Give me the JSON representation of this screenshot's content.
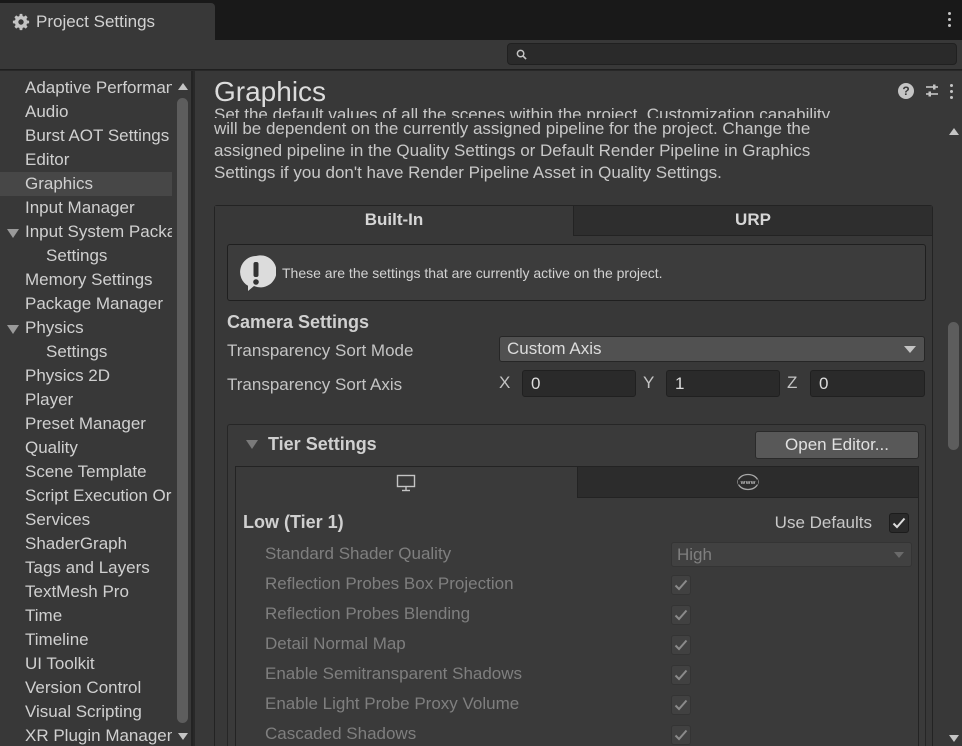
{
  "window": {
    "tab_title": "Project Settings",
    "tab_icon": "gear-icon"
  },
  "search": {
    "placeholder": "",
    "value": ""
  },
  "sidebar": {
    "selected": "Graphics",
    "items": [
      {
        "label": "Adaptive Performance",
        "indent": 0,
        "foldout": false
      },
      {
        "label": "Audio",
        "indent": 0,
        "foldout": false
      },
      {
        "label": "Burst AOT Settings",
        "indent": 0,
        "foldout": false
      },
      {
        "label": "Editor",
        "indent": 0,
        "foldout": false
      },
      {
        "label": "Graphics",
        "indent": 0,
        "foldout": false
      },
      {
        "label": "Input Manager",
        "indent": 0,
        "foldout": false
      },
      {
        "label": "Input System Package",
        "indent": 0,
        "foldout": true
      },
      {
        "label": "Settings",
        "indent": 1,
        "foldout": false
      },
      {
        "label": "Memory Settings",
        "indent": 0,
        "foldout": false
      },
      {
        "label": "Package Manager",
        "indent": 0,
        "foldout": false
      },
      {
        "label": "Physics",
        "indent": 0,
        "foldout": true
      },
      {
        "label": "Settings",
        "indent": 1,
        "foldout": false
      },
      {
        "label": "Physics 2D",
        "indent": 0,
        "foldout": false
      },
      {
        "label": "Player",
        "indent": 0,
        "foldout": false
      },
      {
        "label": "Preset Manager",
        "indent": 0,
        "foldout": false
      },
      {
        "label": "Quality",
        "indent": 0,
        "foldout": false
      },
      {
        "label": "Scene Template",
        "indent": 0,
        "foldout": false
      },
      {
        "label": "Script Execution Order",
        "indent": 0,
        "foldout": false
      },
      {
        "label": "Services",
        "indent": 0,
        "foldout": false
      },
      {
        "label": "ShaderGraph",
        "indent": 0,
        "foldout": false
      },
      {
        "label": "Tags and Layers",
        "indent": 0,
        "foldout": false
      },
      {
        "label": "TextMesh Pro",
        "indent": 0,
        "foldout": false
      },
      {
        "label": "Time",
        "indent": 0,
        "foldout": false
      },
      {
        "label": "Timeline",
        "indent": 0,
        "foldout": false
      },
      {
        "label": "UI Toolkit",
        "indent": 0,
        "foldout": false
      },
      {
        "label": "Version Control",
        "indent": 0,
        "foldout": false
      },
      {
        "label": "Visual Scripting",
        "indent": 0,
        "foldout": false
      },
      {
        "label": "XR Plugin Management",
        "indent": 0,
        "foldout": false
      }
    ]
  },
  "main": {
    "title": "Graphics",
    "description_clipped": "Set the default values of all the scenes within the project. Customization capability",
    "description_lines": [
      "will be dependent on the currently assigned pipeline for the project. Change the",
      "assigned pipeline in the Quality Settings or Default Render Pipeline in Graphics",
      "Settings if you don't have Render Pipeline Asset in Quality Settings."
    ],
    "pipeline_tabs": [
      "Built-In",
      "URP"
    ],
    "active_pipeline_tab": "Built-In",
    "info_box": "These are the settings that are currently active on the project.",
    "camera": {
      "section_title": "Camera Settings",
      "sort_mode_label": "Transparency Sort Mode",
      "sort_mode_value": "Custom Axis",
      "sort_axis_label": "Transparency Sort Axis",
      "axis": {
        "x_label": "X",
        "x": "0",
        "y_label": "Y",
        "y": "1",
        "z_label": "Z",
        "z": "0"
      }
    },
    "tier": {
      "section_title": "Tier Settings",
      "open_editor_label": "Open Editor...",
      "platform_tabs": [
        "standalone-monitor-icon",
        "webgl-www-icon"
      ],
      "tier_name": "Low (Tier 1)",
      "use_defaults_label": "Use Defaults",
      "use_defaults": true,
      "shader_quality_label": "Standard Shader Quality",
      "shader_quality_value": "High",
      "properties": [
        {
          "label": "Reflection Probes Box Projection",
          "checked": true
        },
        {
          "label": "Reflection Probes Blending",
          "checked": true
        },
        {
          "label": "Detail Normal Map",
          "checked": true
        },
        {
          "label": "Enable Semitransparent Shadows",
          "checked": true
        },
        {
          "label": "Enable Light Probe Proxy Volume",
          "checked": true
        },
        {
          "label": "Cascaded Shadows",
          "checked": true
        }
      ]
    }
  },
  "colors": {
    "background": "#383838",
    "titlebar": "#191919",
    "selected": "#474747",
    "field": "#2a2a2a"
  }
}
